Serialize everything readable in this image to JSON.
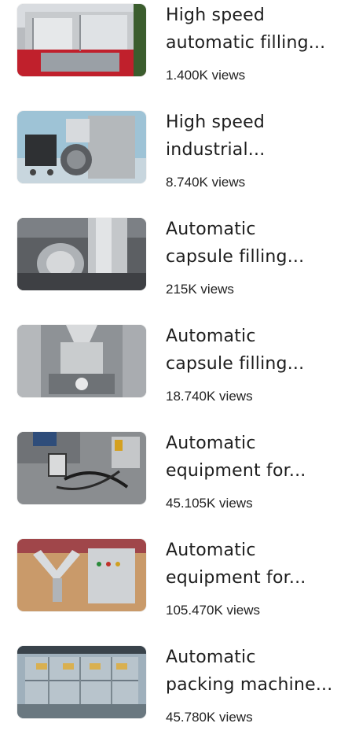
{
  "videos": [
    {
      "title_line1": "High speed",
      "title_line2": "automatic filling...",
      "views": "1.400K views",
      "thumbnail_icon": "machine-thumbnail"
    },
    {
      "title_line1": "High speed",
      "title_line2": "industrial...",
      "views": "8.740K views",
      "thumbnail_icon": "machine-thumbnail"
    },
    {
      "title_line1": "Automatic",
      "title_line2": "capsule filling...",
      "views": "215K views",
      "thumbnail_icon": "machine-thumbnail"
    },
    {
      "title_line1": "Automatic",
      "title_line2": "capsule filling...",
      "views": "18.740K views",
      "thumbnail_icon": "machine-thumbnail"
    },
    {
      "title_line1": "Automatic",
      "title_line2": "equipment for...",
      "views": "45.105K views",
      "thumbnail_icon": "machine-thumbnail"
    },
    {
      "title_line1": "Automatic",
      "title_line2": "equipment for...",
      "views": "105.470K views",
      "thumbnail_icon": "machine-thumbnail"
    },
    {
      "title_line1": "Automatic",
      "title_line2": "packing machine...",
      "views": "45.780K views",
      "thumbnail_icon": "machine-thumbnail"
    }
  ]
}
